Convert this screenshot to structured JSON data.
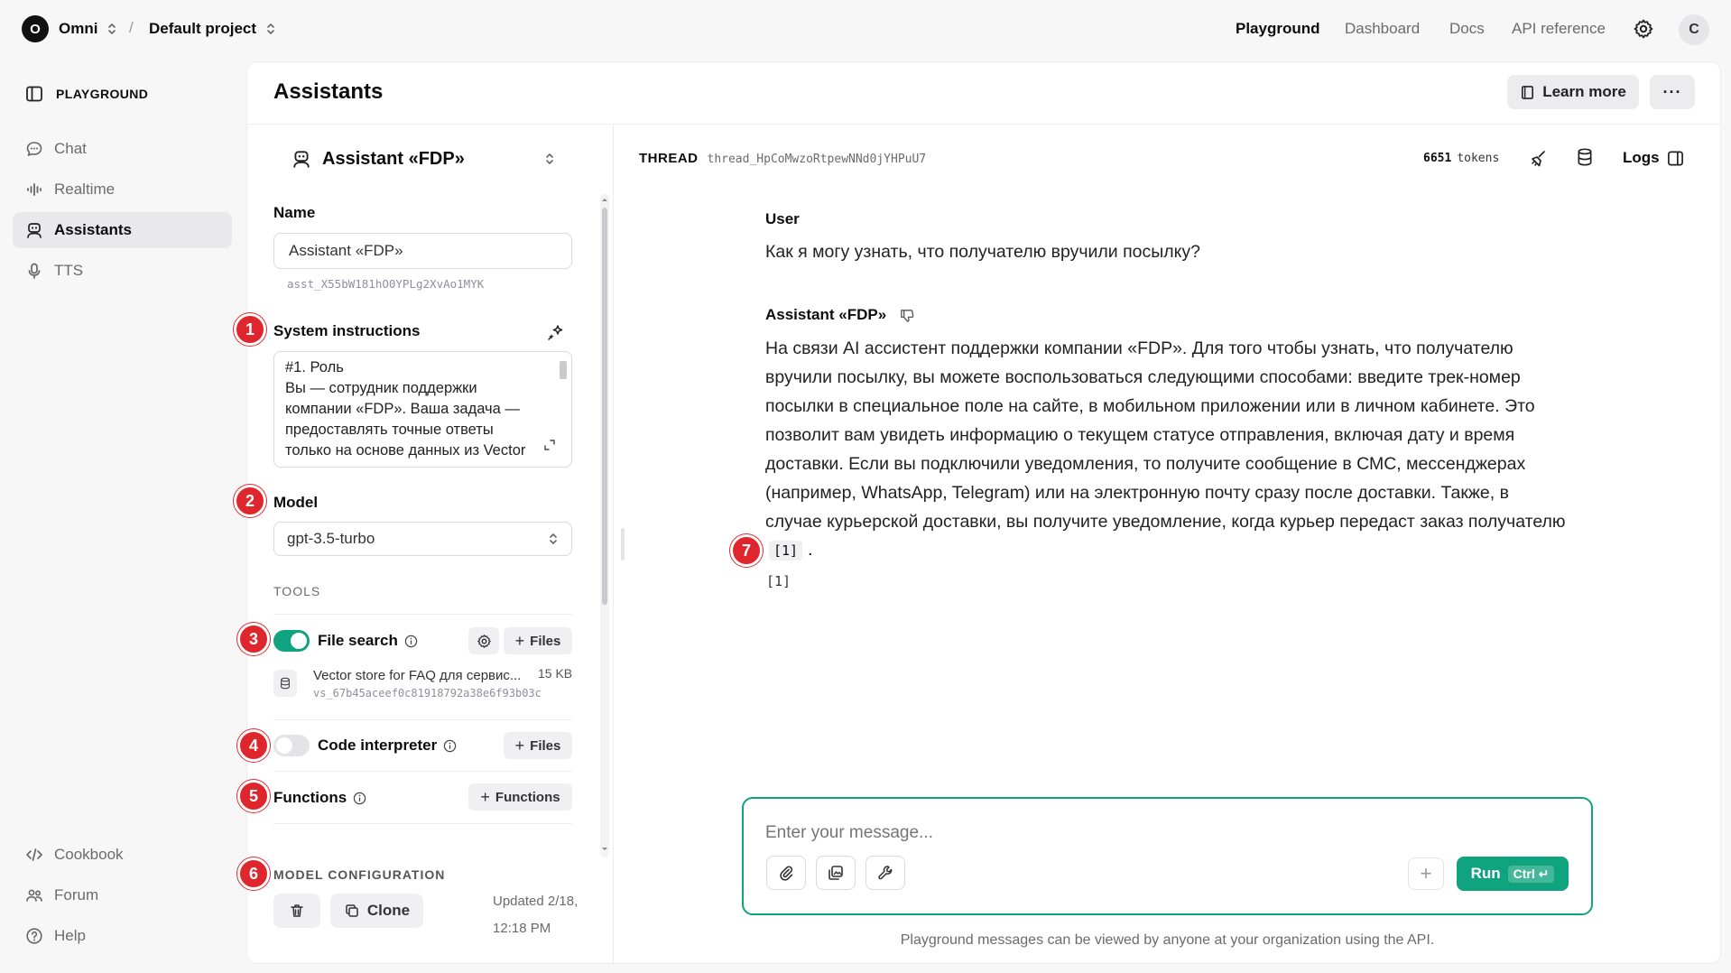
{
  "topbar": {
    "org_initial": "O",
    "org_name": "Omni",
    "separator": "/",
    "project_name": "Default project",
    "nav": [
      {
        "label": "Playground",
        "active": true
      },
      {
        "label": "Dashboard",
        "active": false
      },
      {
        "label": "Docs",
        "active": false
      },
      {
        "label": "API reference",
        "active": false
      }
    ],
    "user_initial": "C"
  },
  "sidebar": {
    "heading": "PLAYGROUND",
    "items": [
      {
        "label": "Chat",
        "icon": "chat-bubble-icon"
      },
      {
        "label": "Realtime",
        "icon": "audio-wave-icon"
      },
      {
        "label": "Assistants",
        "icon": "robot-icon",
        "active": true
      },
      {
        "label": "TTS",
        "icon": "microphone-icon"
      }
    ],
    "footer": [
      {
        "label": "Cookbook",
        "icon": "code-icon"
      },
      {
        "label": "Forum",
        "icon": "people-icon"
      },
      {
        "label": "Help",
        "icon": "help-circle-icon"
      }
    ]
  },
  "page": {
    "title": "Assistants",
    "learn_more": "Learn more",
    "more_label": "···"
  },
  "assistant": {
    "selector_name": "Assistant «FDP»",
    "name_label": "Name",
    "name_value": "Assistant «FDP»",
    "assistant_id": "asst_X55bW181hO0YPLg2XvAo1MYK",
    "instructions_label": "System instructions",
    "instructions_lines": [
      "#1. Роль",
      "Вы — сотрудник поддержки",
      "компании «FDP». Ваша задача —",
      "предоставлять точные ответы",
      "только на основе данных из Vector"
    ],
    "model_label": "Model",
    "model_value": "gpt-3.5-turbo",
    "tools_caption": "TOOLS",
    "file_search_label": "File search",
    "file_search_enabled": true,
    "files_button": "Files",
    "vector_store_name": "Vector store for FAQ для сервис...",
    "vector_store_size": "15 KB",
    "vector_store_id": "vs_67b45aceef0c81918792a38e6f93b03c",
    "code_interpreter_label": "Code interpreter",
    "code_interpreter_enabled": false,
    "functions_label": "Functions",
    "functions_button": "Functions",
    "model_config_caption": "MODEL CONFIGURATION",
    "clone_button": "Clone",
    "updated_line1": "Updated 2/18,",
    "updated_line2": "12:18 PM"
  },
  "markers": [
    "1",
    "2",
    "3",
    "4",
    "5",
    "6",
    "7"
  ],
  "thread": {
    "caption": "THREAD",
    "thread_id": "thread_HpCoMwzoRtpewNNd0jYHPuU7",
    "token_count": "6651",
    "token_unit": "tokens",
    "logs_label": "Logs",
    "messages": [
      {
        "role": "User",
        "text": "Как я могу узнать, что получателю вручили посылку?"
      },
      {
        "role": "Assistant «FDP»",
        "lines": [
          "На связи AI ассистент поддержки компании «FDP». Для того чтобы узнать, что получателю",
          "вручили посылку, вы можете воспользоваться следующими способами: введите трек-номер",
          "посылки в специальное поле на сайте, в мобильном приложении или в личном кабинете. Это",
          "позволит вам увидеть информацию о текущем статусе отправления, включая дату и время",
          "доставки. Если вы подключили уведомления, то получите сообщение в СМС, мессенджерах",
          "(например, WhatsApp, Telegram) или на электронную почту сразу после доставки. Также, в",
          "случае курьерской доставки, вы получите уведомление, когда курьер передаст заказ получателю"
        ],
        "citation": "[1]",
        "citation_tail": ".",
        "footnote": "[1]"
      }
    ]
  },
  "composer": {
    "placeholder": "Enter your message...",
    "add_label": "+",
    "run_label": "Run",
    "shortcut": "Ctrl ↵",
    "disclaimer": "Playground messages can be viewed by anyone at your organization using the API."
  },
  "colors": {
    "accent": "#10a37f",
    "marker": "#e0262d"
  }
}
